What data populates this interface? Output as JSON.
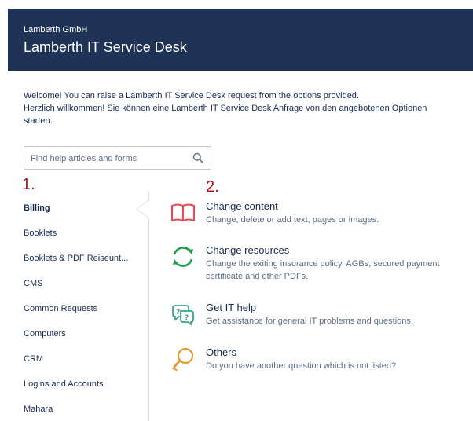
{
  "header": {
    "org": "Lamberth GmbH",
    "title": "Lamberth IT Service Desk"
  },
  "welcome": {
    "line1": "Welcome! You can raise a Lamberth IT Service Desk request from the options provided.",
    "line2": "Herzlich willkommen! Sie können eine Lamberth IT Service Desk Anfrage von den angebotenen Optionen starten."
  },
  "search": {
    "placeholder": "Find help articles and forms",
    "icon": "search-icon"
  },
  "markers": {
    "one": "1.",
    "two": "2."
  },
  "sidebar": {
    "items": [
      {
        "label": "Billing",
        "active": true
      },
      {
        "label": "Booklets"
      },
      {
        "label": "Booklets & PDF Reiseunt..."
      },
      {
        "label": "CMS"
      },
      {
        "label": "Common Requests"
      },
      {
        "label": "Computers"
      },
      {
        "label": "CRM"
      },
      {
        "label": "Logins and Accounts"
      },
      {
        "label": "Mahara"
      }
    ]
  },
  "requests": [
    {
      "name": "Change content",
      "desc": "Change, delete or add text, pages or images.",
      "icon": "book-icon",
      "color": "#e5484d"
    },
    {
      "name": "Change resources",
      "desc": "Change the exiting insurance policy, AGBs, secured payment certificate and other PDFs.",
      "icon": "refresh-icon",
      "color": "#1e9e4a"
    },
    {
      "name": "Get IT help",
      "desc": "Get assistance for general IT problems and questions.",
      "icon": "speech-bubbles-icon",
      "color": "#3aa38a"
    },
    {
      "name": "Others",
      "desc": "Do you have another question which is not listed?",
      "icon": "lightbulb-icon",
      "color": "#e39b2b"
    }
  ],
  "colors": {
    "header_bg": "#1f3356",
    "marker": "#b4121b",
    "text": "#172b4d",
    "muted": "#5e6c84"
  }
}
